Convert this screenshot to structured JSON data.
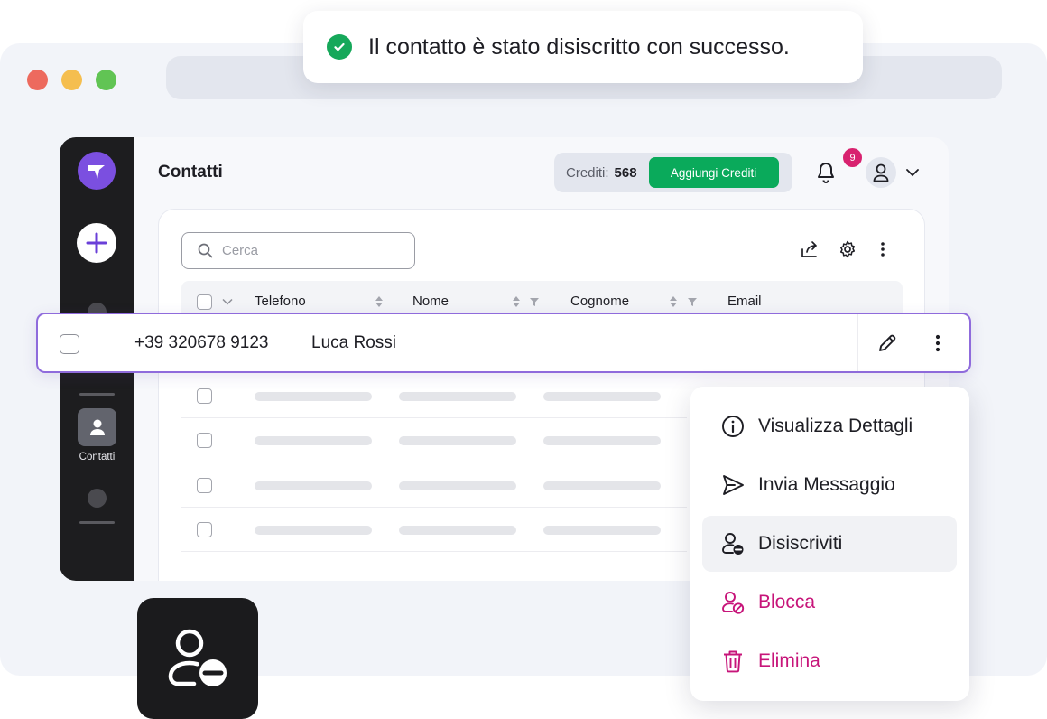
{
  "toast": {
    "message": "Il contatto è stato disiscritto con successo."
  },
  "sidebar": {
    "active_label": "Contatti"
  },
  "header": {
    "title": "Contatti",
    "credits_label": "Crediti:",
    "credits_value": "568",
    "add_credits_label": "Aggiungi Crediti",
    "notification_count": "9"
  },
  "search": {
    "placeholder": "Cerca"
  },
  "table": {
    "columns": [
      "Telefono",
      "Nome",
      "Cognome",
      "Email"
    ]
  },
  "selected_row": {
    "phone": "+39 320678 9123",
    "name": "Luca Rossi"
  },
  "context_menu": {
    "items": [
      {
        "label": "Visualizza Dettagli",
        "icon": "info-icon"
      },
      {
        "label": "Invia Messaggio",
        "icon": "send-icon"
      },
      {
        "label": "Disiscriviti",
        "icon": "user-unsubscribe-icon"
      },
      {
        "label": "Blocca",
        "icon": "user-block-icon"
      },
      {
        "label": "Elimina",
        "icon": "trash-icon"
      }
    ]
  },
  "colors": {
    "accent": "#7b4fe0",
    "success": "#0aaa5b",
    "danger": "#c7157a",
    "badge": "#d8226f"
  }
}
